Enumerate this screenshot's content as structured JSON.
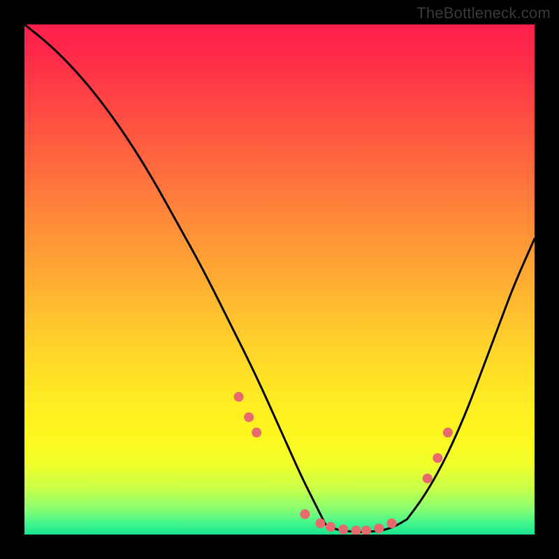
{
  "watermark": "TheBottleneck.com",
  "chart_data": {
    "type": "line",
    "title": "",
    "xlabel": "",
    "ylabel": "",
    "xlim": [
      0,
      100
    ],
    "ylim": [
      0,
      100
    ],
    "gradient_stops": [
      {
        "pos": 0,
        "color": "#ff1f4a"
      },
      {
        "pos": 15,
        "color": "#ff4443"
      },
      {
        "pos": 40,
        "color": "#ff8f38"
      },
      {
        "pos": 63,
        "color": "#ffd22a"
      },
      {
        "pos": 80,
        "color": "#fff61e"
      },
      {
        "pos": 95,
        "color": "#88ff70"
      },
      {
        "pos": 100,
        "color": "#18e38e"
      }
    ],
    "series": [
      {
        "name": "left-branch",
        "x": [
          0,
          5,
          10,
          15,
          20,
          25,
          30,
          35,
          40,
          45,
          50,
          54,
          57,
          59
        ],
        "y": [
          100,
          96,
          91,
          85,
          78,
          70,
          61,
          52,
          42,
          32,
          21,
          12,
          6,
          2
        ]
      },
      {
        "name": "valley-floor",
        "x": [
          59,
          61,
          63,
          65,
          67,
          69,
          71,
          73,
          75
        ],
        "y": [
          2,
          1,
          0.7,
          0.5,
          0.5,
          0.7,
          1,
          1.8,
          3
        ]
      },
      {
        "name": "right-branch",
        "x": [
          75,
          78,
          81,
          84,
          87,
          90,
          93,
          96,
          100
        ],
        "y": [
          3,
          7,
          12,
          18,
          25,
          33,
          41,
          49,
          58
        ]
      }
    ],
    "markers": {
      "name": "valley-dots",
      "color": "#e86a6e",
      "radius_px": 7,
      "x": [
        42,
        44,
        45.5,
        55,
        58,
        60,
        62.5,
        65,
        67,
        69.5,
        72,
        79,
        81,
        83
      ],
      "y": [
        27,
        23,
        20,
        4,
        2.2,
        1.5,
        1.0,
        0.8,
        0.8,
        1.2,
        2.2,
        11,
        15,
        20
      ]
    }
  }
}
